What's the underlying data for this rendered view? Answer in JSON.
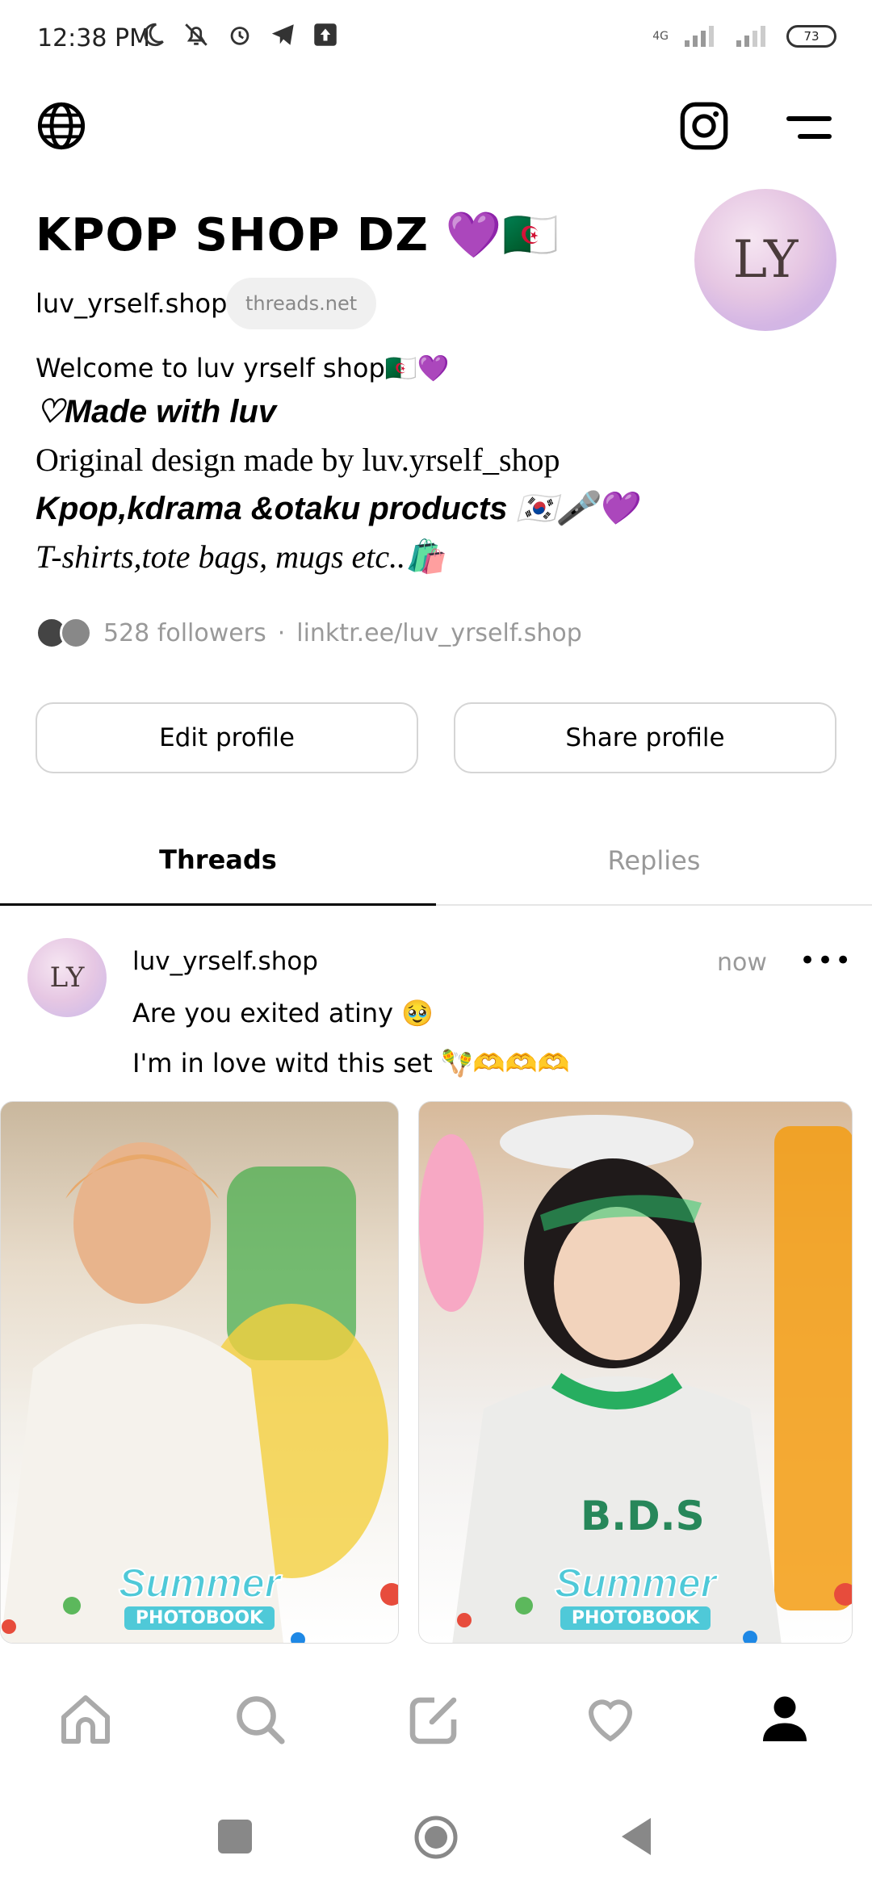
{
  "status_bar": {
    "time": "12:38 PM",
    "network": "4G",
    "battery": "73"
  },
  "profile": {
    "name": "KPOP SHOP DZ 💜🇩🇿",
    "handle": "luv_yrself.shop",
    "domain_badge": "threads.net",
    "avatar_text": "LY",
    "bio": [
      "Welcome to luv yrself shop🇩🇿💜",
      "♡Made with luv",
      "Original design made by luv.yrself_shop",
      "Kpop,kdrama &otaku products 🇰🇷🎤💜",
      "T-shirts,tote bags, mugs etc..🛍️"
    ],
    "followers": "528 followers",
    "separator": "·",
    "link": "linktr.ee/luv_yrself.shop"
  },
  "buttons": {
    "edit": "Edit profile",
    "share": "Share profile"
  },
  "tabs": [
    {
      "label": "Threads"
    },
    {
      "label": "Replies"
    }
  ],
  "post": {
    "username": "luv_yrself.shop",
    "time": "now",
    "more": "•••",
    "line1": "Are you exited atiny 🥹",
    "line2": "I'm in love witd this set 🪇🫶🫶🫶",
    "media": [
      {
        "caption": "Summer",
        "subcaption": "PHOTOBOOK"
      },
      {
        "caption": "Summer",
        "subcaption": "PHOTOBOOK",
        "shirt_text": "B.D.S"
      }
    ]
  },
  "icons": {
    "globe": "globe-icon",
    "instagram": "instagram-icon",
    "menu": "menu-icon",
    "home": "home-icon",
    "search": "search-icon",
    "compose": "compose-icon",
    "activity": "heart-icon",
    "profile": "profile-icon"
  },
  "colors": {
    "accent": "#000000",
    "muted": "#999999",
    "border": "#d5d5d5"
  }
}
